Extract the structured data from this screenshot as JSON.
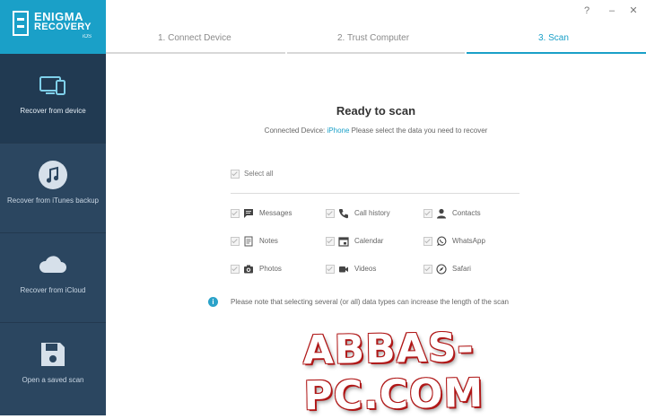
{
  "logo": {
    "line1": "ENIGMA",
    "line2": "RECOVERY",
    "line3": "iOS"
  },
  "sidebar": {
    "items": [
      {
        "label": "Recover from device",
        "icon": "device-icon",
        "active": true
      },
      {
        "label": "Recover from iTunes backup",
        "icon": "music-note-icon",
        "active": false
      },
      {
        "label": "Recover from iCloud",
        "icon": "cloud-icon",
        "active": false
      },
      {
        "label": "Open a saved scan",
        "icon": "save-disk-icon",
        "active": false
      }
    ]
  },
  "steps": [
    {
      "label": "1. Connect Device",
      "active": false
    },
    {
      "label": "2. Trust Computer",
      "active": false
    },
    {
      "label": "3. Scan",
      "active": true
    }
  ],
  "window_controls": {
    "help": "?",
    "minimize": "–",
    "close": "✕"
  },
  "main": {
    "title": "Ready to scan",
    "subtitle_prefix": "Connected Device:",
    "device_name": "iPhone",
    "subtitle_suffix": "Please select the data you need to recover",
    "select_all": "Select all",
    "options": [
      {
        "label": "Messages",
        "icon": "message-icon"
      },
      {
        "label": "Call history",
        "icon": "phone-icon"
      },
      {
        "label": "Contacts",
        "icon": "contact-icon"
      },
      {
        "label": "Notes",
        "icon": "notes-icon"
      },
      {
        "label": "Calendar",
        "icon": "calendar-icon"
      },
      {
        "label": "WhatsApp",
        "icon": "whatsapp-icon"
      },
      {
        "label": "Photos",
        "icon": "camera-icon"
      },
      {
        "label": "Videos",
        "icon": "video-icon"
      },
      {
        "label": "Safari",
        "icon": "safari-icon"
      }
    ],
    "note_icon": "i",
    "note": "Please note that selecting several (or all) data types can increase the length of the scan"
  },
  "watermark": "ABBAS-PC.COM",
  "colors": {
    "accent": "#1aa0c8",
    "sidebar": "#2b4660",
    "sidebar_active": "#213a52"
  }
}
